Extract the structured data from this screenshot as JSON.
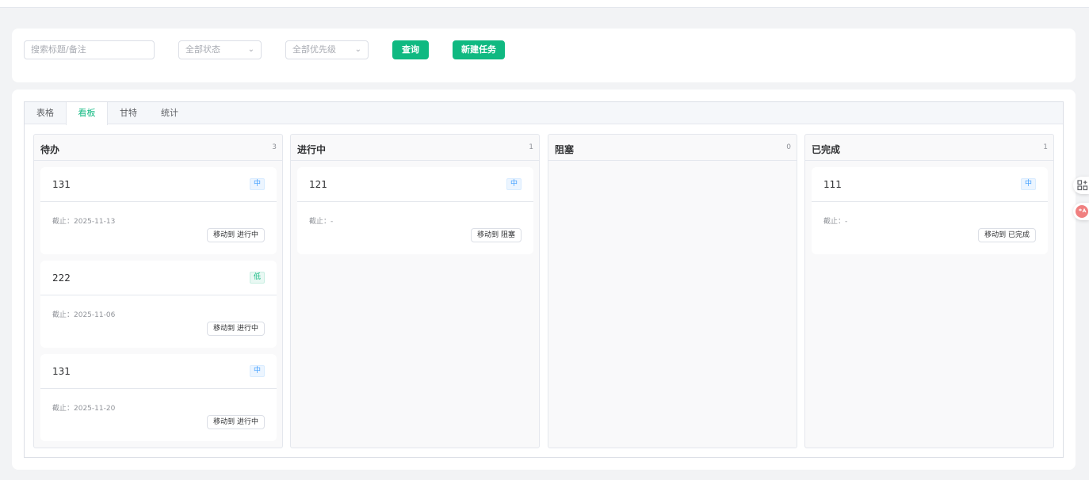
{
  "filters": {
    "search_placeholder": "搜索标题/备注",
    "status_label": "全部状态",
    "priority_label": "全部优先级",
    "query_label": "查询",
    "new_task_label": "新建任务"
  },
  "tabs": [
    {
      "label": "表格"
    },
    {
      "label": "看板"
    },
    {
      "label": "甘特"
    },
    {
      "label": "统计"
    }
  ],
  "active_tab": "看板",
  "columns": [
    {
      "title": "待办",
      "count": "3",
      "tasks": [
        {
          "title": "131",
          "priority": "中",
          "due": "截止：2025-11-13",
          "action": "移动到 进行中"
        },
        {
          "title": "222",
          "priority": "低",
          "due": "截止：2025-11-06",
          "action": "移动到 进行中"
        },
        {
          "title": "131",
          "priority": "中",
          "due": "截止：2025-11-20",
          "action": "移动到 进行中"
        }
      ]
    },
    {
      "title": "进行中",
      "count": "1",
      "tasks": [
        {
          "title": "121",
          "priority": "中",
          "due": "截止：-",
          "action": "移动到 阻塞"
        }
      ]
    },
    {
      "title": "阻塞",
      "count": "0",
      "tasks": []
    },
    {
      "title": "已完成",
      "count": "1",
      "tasks": [
        {
          "title": "111",
          "priority": "中",
          "due": "截止：-",
          "action": "移动到 已完成"
        }
      ]
    }
  ],
  "accent_color": "#10b981",
  "icons": [
    "chevron-down-icon",
    "grid-plus-icon",
    "translate-icon"
  ]
}
